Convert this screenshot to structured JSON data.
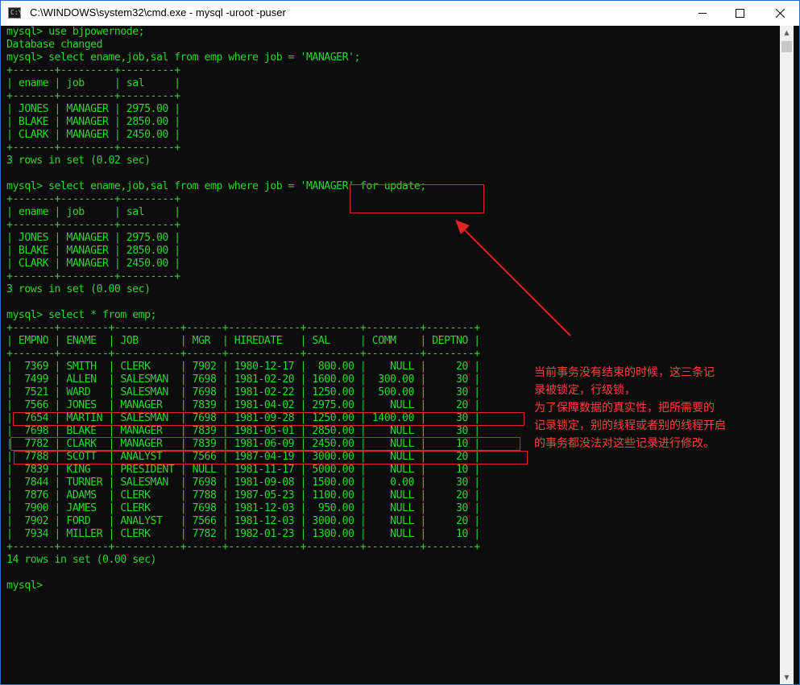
{
  "window": {
    "title": "C:\\WINDOWS\\system32\\cmd.exe - mysql  -uroot -puser",
    "icon_label": "C:\\",
    "icons": {
      "app": "cmd-icon",
      "minimize": "minimize-icon",
      "maximize": "maximize-icon",
      "close": "close-icon"
    }
  },
  "console": {
    "lines": [
      "mysql> use bjpowernode;",
      "Database changed",
      "mysql> select ename,job,sal from emp where job = 'MANAGER';",
      "+-------+---------+---------+",
      "| ename | job     | sal     |",
      "+-------+---------+---------+",
      "| JONES | MANAGER | 2975.00 |",
      "| BLAKE | MANAGER | 2850.00 |",
      "| CLARK | MANAGER | 2450.00 |",
      "+-------+---------+---------+",
      "3 rows in set (0.02 sec)",
      "",
      "mysql> select ename,job,sal from emp where job = 'MANAGER' for update;",
      "+-------+---------+---------+",
      "| ename | job     | sal     |",
      "+-------+---------+---------+",
      "| JONES | MANAGER | 2975.00 |",
      "| BLAKE | MANAGER | 2850.00 |",
      "| CLARK | MANAGER | 2450.00 |",
      "+-------+---------+---------+",
      "3 rows in set (0.00 sec)",
      "",
      "mysql> select * from emp;",
      "+-------+--------+-----------+------+------------+---------+---------+--------+",
      "| EMPNO | ENAME  | JOB       | MGR  | HIREDATE   | SAL     | COMM    | DEPTNO |",
      "+-------+--------+-----------+------+------------+---------+---------+--------+",
      "|  7369 | SMITH  | CLERK     | 7902 | 1980-12-17 |  800.00 |    NULL |     20 |",
      "|  7499 | ALLEN  | SALESMAN  | 7698 | 1981-02-20 | 1600.00 |  300.00 |     30 |",
      "|  7521 | WARD   | SALESMAN  | 7698 | 1981-02-22 | 1250.00 |  500.00 |     30 |",
      "|  7566 | JONES  | MANAGER   | 7839 | 1981-04-02 | 2975.00 |    NULL |     20 |",
      "|  7654 | MARTIN | SALESMAN  | 7698 | 1981-09-28 | 1250.00 | 1400.00 |     30 |",
      "|  7698 | BLAKE  | MANAGER   | 7839 | 1981-05-01 | 2850.00 |    NULL |     30 |",
      "|  7782 | CLARK  | MANAGER   | 7839 | 1981-06-09 | 2450.00 |    NULL |     10 |",
      "|  7788 | SCOTT  | ANALYST   | 7566 | 1987-04-19 | 3000.00 |    NULL |     20 |",
      "|  7839 | KING   | PRESIDENT | NULL | 1981-11-17 | 5000.00 |    NULL |     10 |",
      "|  7844 | TURNER | SALESMAN  | 7698 | 1981-09-08 | 1500.00 |    0.00 |     30 |",
      "|  7876 | ADAMS  | CLERK     | 7788 | 1987-05-23 | 1100.00 |    NULL |     20 |",
      "|  7900 | JAMES  | CLERK     | 7698 | 1981-12-03 |  950.00 |    NULL |     30 |",
      "|  7902 | FORD   | ANALYST   | 7566 | 1981-12-03 | 3000.00 |    NULL |     20 |",
      "|  7934 | MILLER | CLERK     | 7782 | 1982-01-23 | 1300.00 |    NULL |     10 |",
      "+-------+--------+-----------+------+------------+---------+---------+--------+",
      "14 rows in set (0.00 sec)",
      "",
      "mysql>"
    ]
  },
  "scrollbar": {
    "up_glyph": "▲",
    "down_glyph": "▼"
  },
  "annotation": {
    "color": "#ff4040",
    "lines": [
      "当前事务没有结束的时候，这三条记",
      "录被锁定，行级锁，",
      "为了保障数据的真实性，把所需要的",
      "记录锁定，别的线程或者别的线程开启",
      "的事务都没法对这些记录进行修改。"
    ]
  },
  "colors": {
    "console_text": "#2cd42c",
    "console_bg": "#0c0c0c",
    "highlight": "#e02424"
  }
}
